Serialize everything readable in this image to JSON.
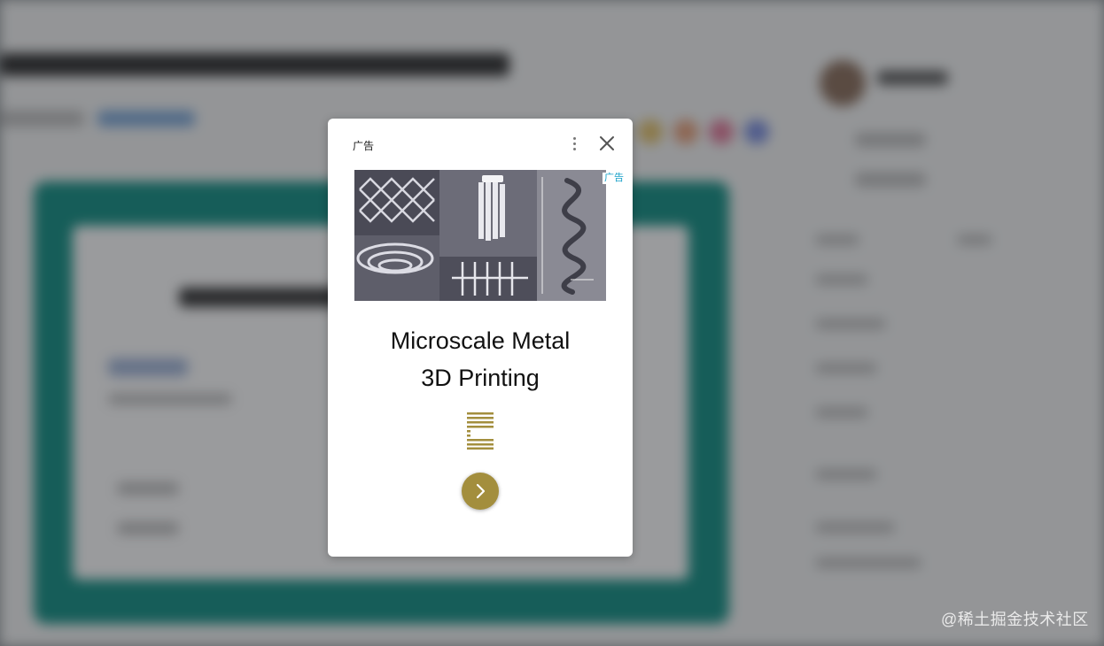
{
  "ad_dialog": {
    "ad_label": "广告",
    "badge_label": "广告",
    "headline_line1": "Microscale Metal",
    "headline_line2": "3D Printing",
    "icons": {
      "menu": "more-vertical-icon",
      "close": "close-icon",
      "cta": "chevron-right-icon",
      "brand": "brand-logo-icon"
    },
    "colors": {
      "brand_gold": "#a38e3d",
      "badge_text": "#16a0c8"
    }
  },
  "watermark": "@稀土掘金技术社区"
}
